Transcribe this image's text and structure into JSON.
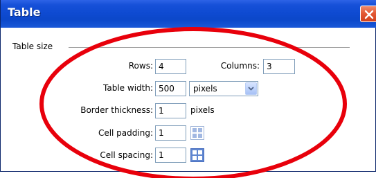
{
  "window": {
    "title": "Table"
  },
  "group": {
    "label": "Table size"
  },
  "rows": {
    "label": "Rows:",
    "value": "4"
  },
  "columns": {
    "label": "Columns:",
    "value": "3"
  },
  "table_width": {
    "label": "Table width:",
    "value": "500",
    "unit_selected": "pixels"
  },
  "border_thickness": {
    "label": "Border thickness:",
    "value": "1",
    "unit": "pixels"
  },
  "cell_padding": {
    "label": "Cell padding:",
    "value": "1",
    "icon": "cell-padding-icon"
  },
  "cell_spacing": {
    "label": "Cell spacing:",
    "value": "1",
    "icon": "cell-spacing-icon"
  },
  "colors": {
    "titlebar": "#0b47c9",
    "close": "#e45a35",
    "annotation": "#e8000b",
    "field_border": "#7f9db9"
  }
}
